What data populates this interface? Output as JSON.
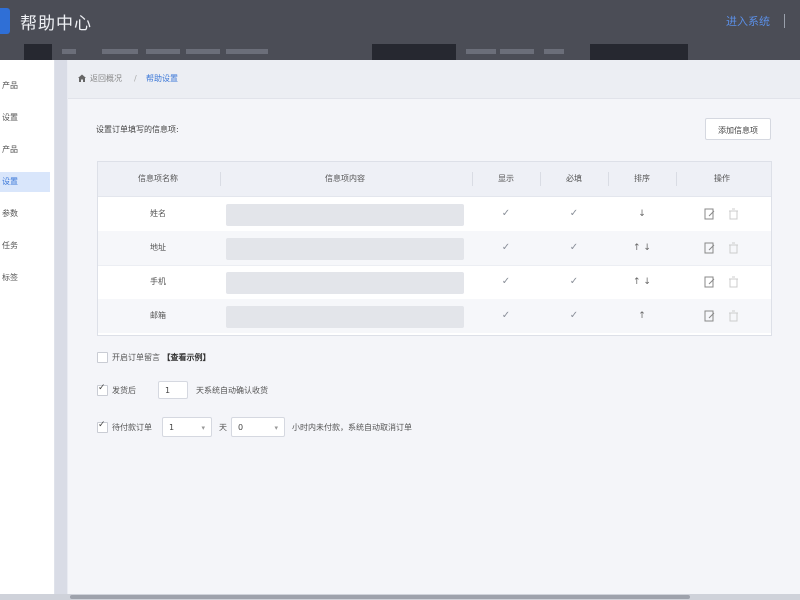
{
  "header": {
    "title": "帮助中心",
    "login_label": "进入系统"
  },
  "sidebar": {
    "items": [
      {
        "label": "产品"
      },
      {
        "label": "设置"
      },
      {
        "label": "产品"
      },
      {
        "label": "设置",
        "active": true
      },
      {
        "label": "参数"
      },
      {
        "label": "任务"
      },
      {
        "label": "标签"
      }
    ]
  },
  "breadcrumb": {
    "items": [
      "返回概况",
      "帮助设置"
    ],
    "separator": "/"
  },
  "main": {
    "section_title": "设置订单填写的信息项:",
    "add_button_label": "添加信息项"
  },
  "table": {
    "headers": {
      "name": "信息项名称",
      "content": "信息项内容",
      "show": "显示",
      "required": "必填",
      "sort": "排序",
      "action": "操作"
    },
    "rows": [
      {
        "name": "姓名",
        "show": "✓",
        "required": "✓",
        "sort": "↓"
      },
      {
        "name": "地址",
        "show": "✓",
        "required": "✓",
        "sort": "↑ ↓"
      },
      {
        "name": "手机",
        "show": "✓",
        "required": "✓",
        "sort": "↑ ↓"
      },
      {
        "name": "邮箱",
        "show": "✓",
        "required": "✓",
        "sort": "↑"
      }
    ]
  },
  "settings": {
    "remark": {
      "label": "开启订单留言",
      "link": "【查看示例】",
      "checked": false
    },
    "auto_receive": {
      "prefix": "发货后",
      "days": "1",
      "suffix": "天系统自动确认收货",
      "checked": true
    },
    "auto_cancel": {
      "prefix": "待付款订单",
      "days": "1",
      "days_unit": "天",
      "hours": "0",
      "suffix": "小时内未付款，系统自动取消订单",
      "checked": true
    }
  },
  "colors": {
    "accent": "#3c78d8",
    "header_bg": "#4b4d56"
  },
  "icons": {
    "home": "home-icon",
    "edit": "edit-icon",
    "delete": "delete-icon"
  }
}
